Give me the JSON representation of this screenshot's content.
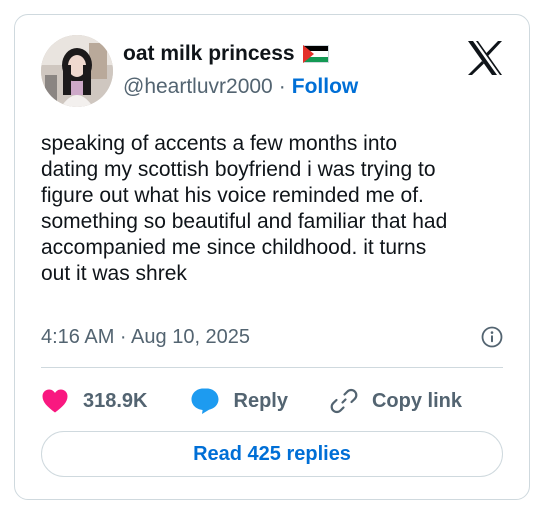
{
  "author": {
    "display_name": "oat milk princess",
    "handle": "@heartluvr2000",
    "separator": "·",
    "follow_label": "Follow",
    "flag_icon": "palestine-flag-icon"
  },
  "tweet": {
    "text": "speaking of accents a few months into\ndating my scottish boyfriend i was trying to\nfigure out what his voice reminded me of.\nsomething so beautiful and familiar that had\naccompanied me since childhood. it turns\nout it was shrek",
    "timestamp": "4:16 AM · Aug 10, 2025"
  },
  "actions": {
    "likes": "318.9K",
    "reply_label": "Reply",
    "copy_link_label": "Copy link"
  },
  "read_replies_label": "Read 425 replies",
  "colors": {
    "link_blue": "#006fd6",
    "heart_pink": "#f91880",
    "reply_blue": "#1d9bf0",
    "muted_text": "#536471",
    "border": "#cfd9de"
  }
}
